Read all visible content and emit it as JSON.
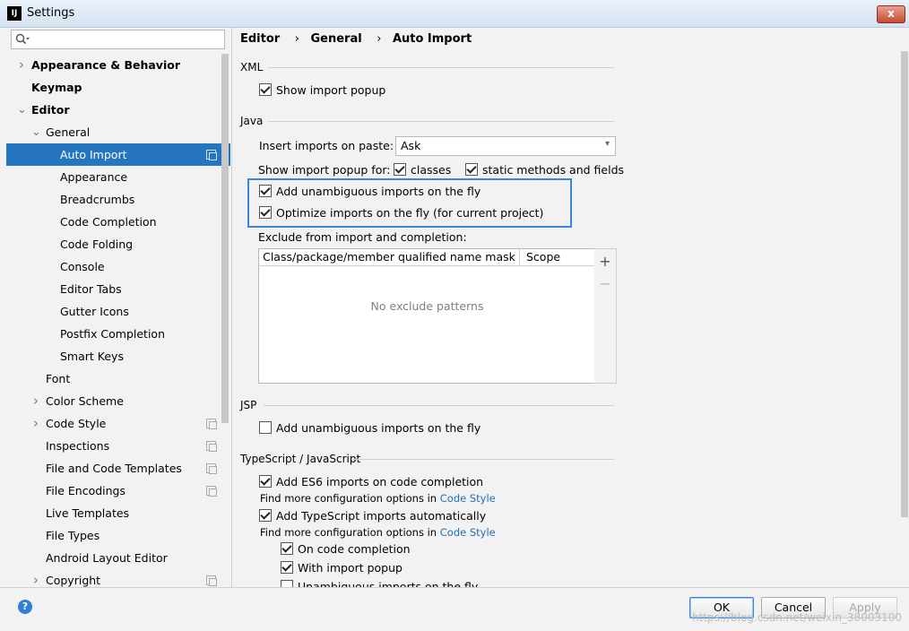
{
  "window": {
    "title": "Settings",
    "app_icon": "intellij-icon",
    "close_label": "x"
  },
  "search": {
    "placeholder": ""
  },
  "tree": [
    {
      "label": "Appearance & Behavior",
      "bold": true,
      "arrow": "right",
      "level": 0
    },
    {
      "label": "Keymap",
      "bold": true,
      "arrow": "",
      "level": 0
    },
    {
      "label": "Editor",
      "bold": true,
      "arrow": "down",
      "level": 0
    },
    {
      "label": "General",
      "bold": false,
      "arrow": "down",
      "level": 1
    },
    {
      "label": "Auto Import",
      "bold": false,
      "arrow": "",
      "level": 2,
      "selected": true,
      "project": true
    },
    {
      "label": "Appearance",
      "bold": false,
      "arrow": "",
      "level": 2
    },
    {
      "label": "Breadcrumbs",
      "bold": false,
      "arrow": "",
      "level": 2
    },
    {
      "label": "Code Completion",
      "bold": false,
      "arrow": "",
      "level": 2
    },
    {
      "label": "Code Folding",
      "bold": false,
      "arrow": "",
      "level": 2
    },
    {
      "label": "Console",
      "bold": false,
      "arrow": "",
      "level": 2
    },
    {
      "label": "Editor Tabs",
      "bold": false,
      "arrow": "",
      "level": 2
    },
    {
      "label": "Gutter Icons",
      "bold": false,
      "arrow": "",
      "level": 2
    },
    {
      "label": "Postfix Completion",
      "bold": false,
      "arrow": "",
      "level": 2
    },
    {
      "label": "Smart Keys",
      "bold": false,
      "arrow": "",
      "level": 2
    },
    {
      "label": "Font",
      "bold": false,
      "arrow": "",
      "level": 1
    },
    {
      "label": "Color Scheme",
      "bold": false,
      "arrow": "right",
      "level": 1
    },
    {
      "label": "Code Style",
      "bold": false,
      "arrow": "right",
      "level": 1,
      "project": true
    },
    {
      "label": "Inspections",
      "bold": false,
      "arrow": "",
      "level": 1,
      "project": true
    },
    {
      "label": "File and Code Templates",
      "bold": false,
      "arrow": "",
      "level": 1,
      "project": true
    },
    {
      "label": "File Encodings",
      "bold": false,
      "arrow": "",
      "level": 1,
      "project": true
    },
    {
      "label": "Live Templates",
      "bold": false,
      "arrow": "",
      "level": 1
    },
    {
      "label": "File Types",
      "bold": false,
      "arrow": "",
      "level": 1
    },
    {
      "label": "Android Layout Editor",
      "bold": false,
      "arrow": "",
      "level": 1
    },
    {
      "label": "Copyright",
      "bold": false,
      "arrow": "right",
      "level": 1,
      "project": true
    }
  ],
  "breadcrumb": [
    "Editor",
    "General",
    "Auto Import"
  ],
  "breadcrumb_sep": "›",
  "xml": {
    "title": "XML",
    "show_import_popup": {
      "label": "Show import popup",
      "checked": true
    }
  },
  "java": {
    "title": "Java",
    "insert_label": "Insert imports on paste:",
    "insert_value": "Ask",
    "popup_for_label": "Show import popup for:",
    "classes": {
      "label": "classes",
      "checked": true
    },
    "static_methods": {
      "label": "static methods and fields",
      "checked": true
    },
    "add_unambiguous": {
      "label": "Add unambiguous imports on the fly",
      "checked": true
    },
    "optimize": {
      "label": "Optimize imports on the fly (for current project)",
      "checked": true
    },
    "exclude_label": "Exclude from import and completion:",
    "table_headers": [
      "Class/package/member qualified name mask",
      "Scope"
    ],
    "empty_text": "No exclude patterns",
    "add_tool": "+",
    "remove_tool": "−"
  },
  "jsp": {
    "title": "JSP",
    "add_unambiguous": {
      "label": "Add unambiguous imports on the fly",
      "checked": false
    }
  },
  "ts": {
    "title": "TypeScript / JavaScript",
    "es6": {
      "label": "Add ES6 imports on code completion",
      "checked": true
    },
    "find_more_1": "Find more configuration options in ",
    "find_more_2": "Find more configuration options in ",
    "code_style_link": "Code Style",
    "ts_auto": {
      "label": "Add TypeScript imports automatically",
      "checked": true
    },
    "on_completion": {
      "label": "On code completion",
      "checked": true
    },
    "with_popup": {
      "label": "With import popup",
      "checked": true
    },
    "unambiguous": {
      "label": "Unambiguous imports on the fly",
      "checked": false
    }
  },
  "buttons": {
    "ok": "OK",
    "cancel": "Cancel",
    "apply": "Apply",
    "help": "?"
  },
  "watermark": "https://blog.csdn.net/weixin_38003100",
  "colors": {
    "selection": "#2675bf",
    "highlight": "#3c86d9",
    "link": "#2470b3"
  }
}
